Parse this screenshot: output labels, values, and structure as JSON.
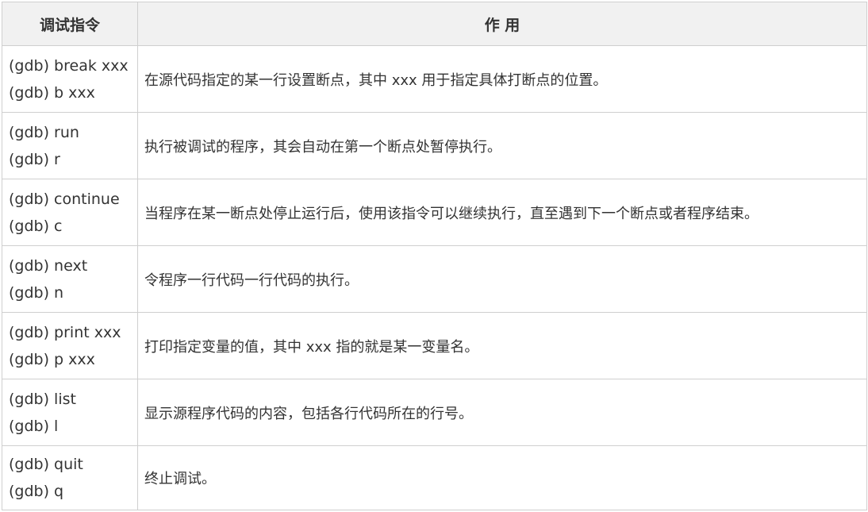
{
  "header": {
    "col_command": "调试指令",
    "col_effect": "作 用"
  },
  "rows": [
    {
      "cmd1": "(gdb) break xxx",
      "cmd2": "(gdb) b xxx",
      "desc": "在源代码指定的某一行设置断点，其中 xxx 用于指定具体打断点的位置。"
    },
    {
      "cmd1": "(gdb) run",
      "cmd2": "(gdb) r",
      "desc": "执行被调试的程序，其会自动在第一个断点处暂停执行。"
    },
    {
      "cmd1": "(gdb) continue",
      "cmd2": "(gdb) c",
      "desc": "当程序在某一断点处停止运行后，使用该指令可以继续执行，直至遇到下一个断点或者程序结束。"
    },
    {
      "cmd1": "(gdb) next",
      "cmd2": "(gdb) n",
      "desc": "令程序一行代码一行代码的执行。"
    },
    {
      "cmd1": "(gdb) print xxx",
      "cmd2": "(gdb) p xxx",
      "desc": "打印指定变量的值，其中 xxx 指的就是某一变量名。"
    },
    {
      "cmd1": "(gdb) list",
      "cmd2": "(gdb) l",
      "desc": "显示源程序代码的内容，包括各行代码所在的行号。"
    },
    {
      "cmd1": "(gdb) quit",
      "cmd2": "(gdb) q",
      "desc": "终止调试。"
    }
  ]
}
